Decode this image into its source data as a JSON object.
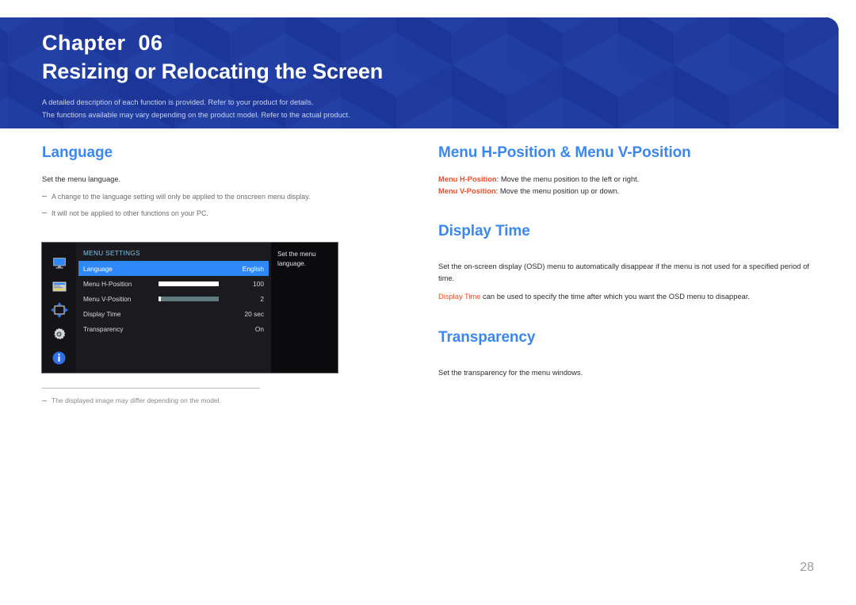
{
  "banner": {
    "chapter_label": "Chapter  06",
    "title": "Resizing or Relocating the Screen",
    "subtitle_line1": "A detailed description of each function is provided. Refer to your product for details.",
    "subtitle_line2": "The functions available may vary depending on the product model. Refer to the actual product.",
    "bg_color": "#1e3a9e",
    "title_color": "#ffffff",
    "subtitle_color": "#c9d4ee"
  },
  "left_column": {
    "heading": "Language",
    "intro": "Set the menu language.",
    "notes": [
      "A change to the language setting will only be applied to the onscreen menu display.",
      "It will not be applied to other functions on your PC."
    ],
    "footnote": "The displayed image may differ depending on the model."
  },
  "osd": {
    "rail_icons": [
      "monitor-icon",
      "picture-in-picture-icon",
      "move-arrows-icon",
      "gear-icon",
      "info-icon"
    ],
    "heading": "MENU SETTINGS",
    "heading_color": "#78c7e8",
    "highlight_color": "#2f88f7",
    "rows": [
      {
        "label": "Language",
        "value": "English",
        "highlighted": true,
        "bar": null
      },
      {
        "label": "Menu H-Position",
        "value": "100",
        "highlighted": false,
        "bar": 100
      },
      {
        "label": "Menu V-Position",
        "value": "2",
        "highlighted": false,
        "bar": 4
      },
      {
        "label": "Display Time",
        "value": "20 sec",
        "highlighted": false,
        "bar": null
      },
      {
        "label": "Transparency",
        "value": "On",
        "highlighted": false,
        "bar": null
      }
    ],
    "side_hint": "Set the menu language."
  },
  "right_column": {
    "section1": {
      "heading": "Menu H-Position & Menu V-Position",
      "line1_label": "Menu H-Position",
      "line1_text": ": Move the menu position to the left or right.",
      "line2_label": "Menu V-Position",
      "line2_text": ": Move the menu position up or down."
    },
    "section2": {
      "heading": "Display Time",
      "paragraph": "Set the on-screen display (OSD) menu to automatically disappear if the menu is not used for a specified period of time.",
      "line2_label": "Display Time",
      "line2_text": " can be used to specify the time after which you want the OSD menu to disappear."
    },
    "section3": {
      "heading": "Transparency",
      "paragraph": "Set the transparency for the menu windows."
    },
    "heading_color": "#3b87ef",
    "accent_color": "#ef4b28"
  },
  "page_number": "28"
}
